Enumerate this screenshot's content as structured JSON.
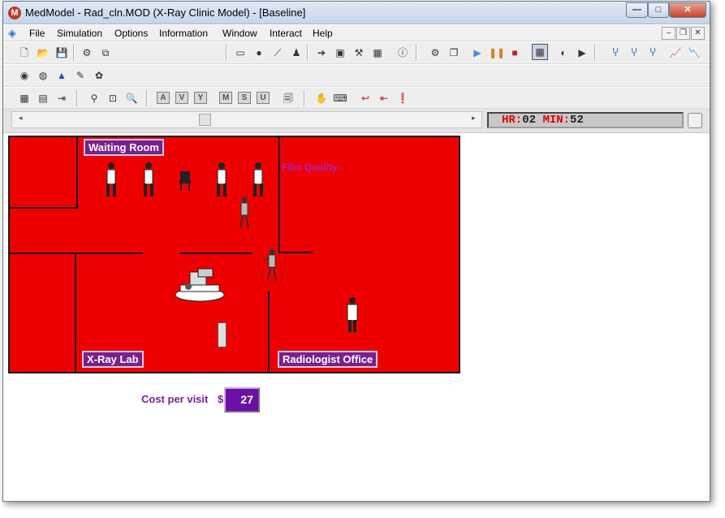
{
  "window": {
    "title": "MedModel - Rad_cln.MOD (X-Ray Clinic Model) - [Baseline]",
    "app_icon": "medmodel-logo-icon",
    "controls": {
      "minimize": "—",
      "maximize": "□",
      "close": "✕"
    }
  },
  "menu": {
    "items": [
      {
        "label": "File",
        "name": "menu-file"
      },
      {
        "label": "Simulation",
        "name": "menu-simulation"
      },
      {
        "label": "Options",
        "name": "menu-options"
      },
      {
        "label": "Information",
        "name": "menu-information"
      },
      {
        "label": "Window",
        "name": "menu-window"
      },
      {
        "label": "Interact",
        "name": "menu-interact"
      },
      {
        "label": "Help",
        "name": "menu-help"
      }
    ],
    "mdi_controls": {
      "minimize": "–",
      "restore": "❐",
      "close": "✕"
    }
  },
  "toolbar_letters": [
    "A",
    "V",
    "Y",
    "M",
    "S",
    "U"
  ],
  "clock": {
    "hr_label": "HR:",
    "hr_value": "02",
    "min_label": "MIN:",
    "min_value": "52"
  },
  "rooms": {
    "waiting_room": "Waiting Room",
    "xray_lab": "X-Ray Lab",
    "radiologist_office": "Radiologist Office"
  },
  "film_quality_label": "Film Quality:",
  "cost": {
    "label": "Cost per visit",
    "currency": "$",
    "value": "27"
  },
  "colors": {
    "floor": "#ee0000",
    "label_bg": "#7a1f8f",
    "cost_box": "#6a0fa8",
    "clock_label": "#e00000"
  }
}
